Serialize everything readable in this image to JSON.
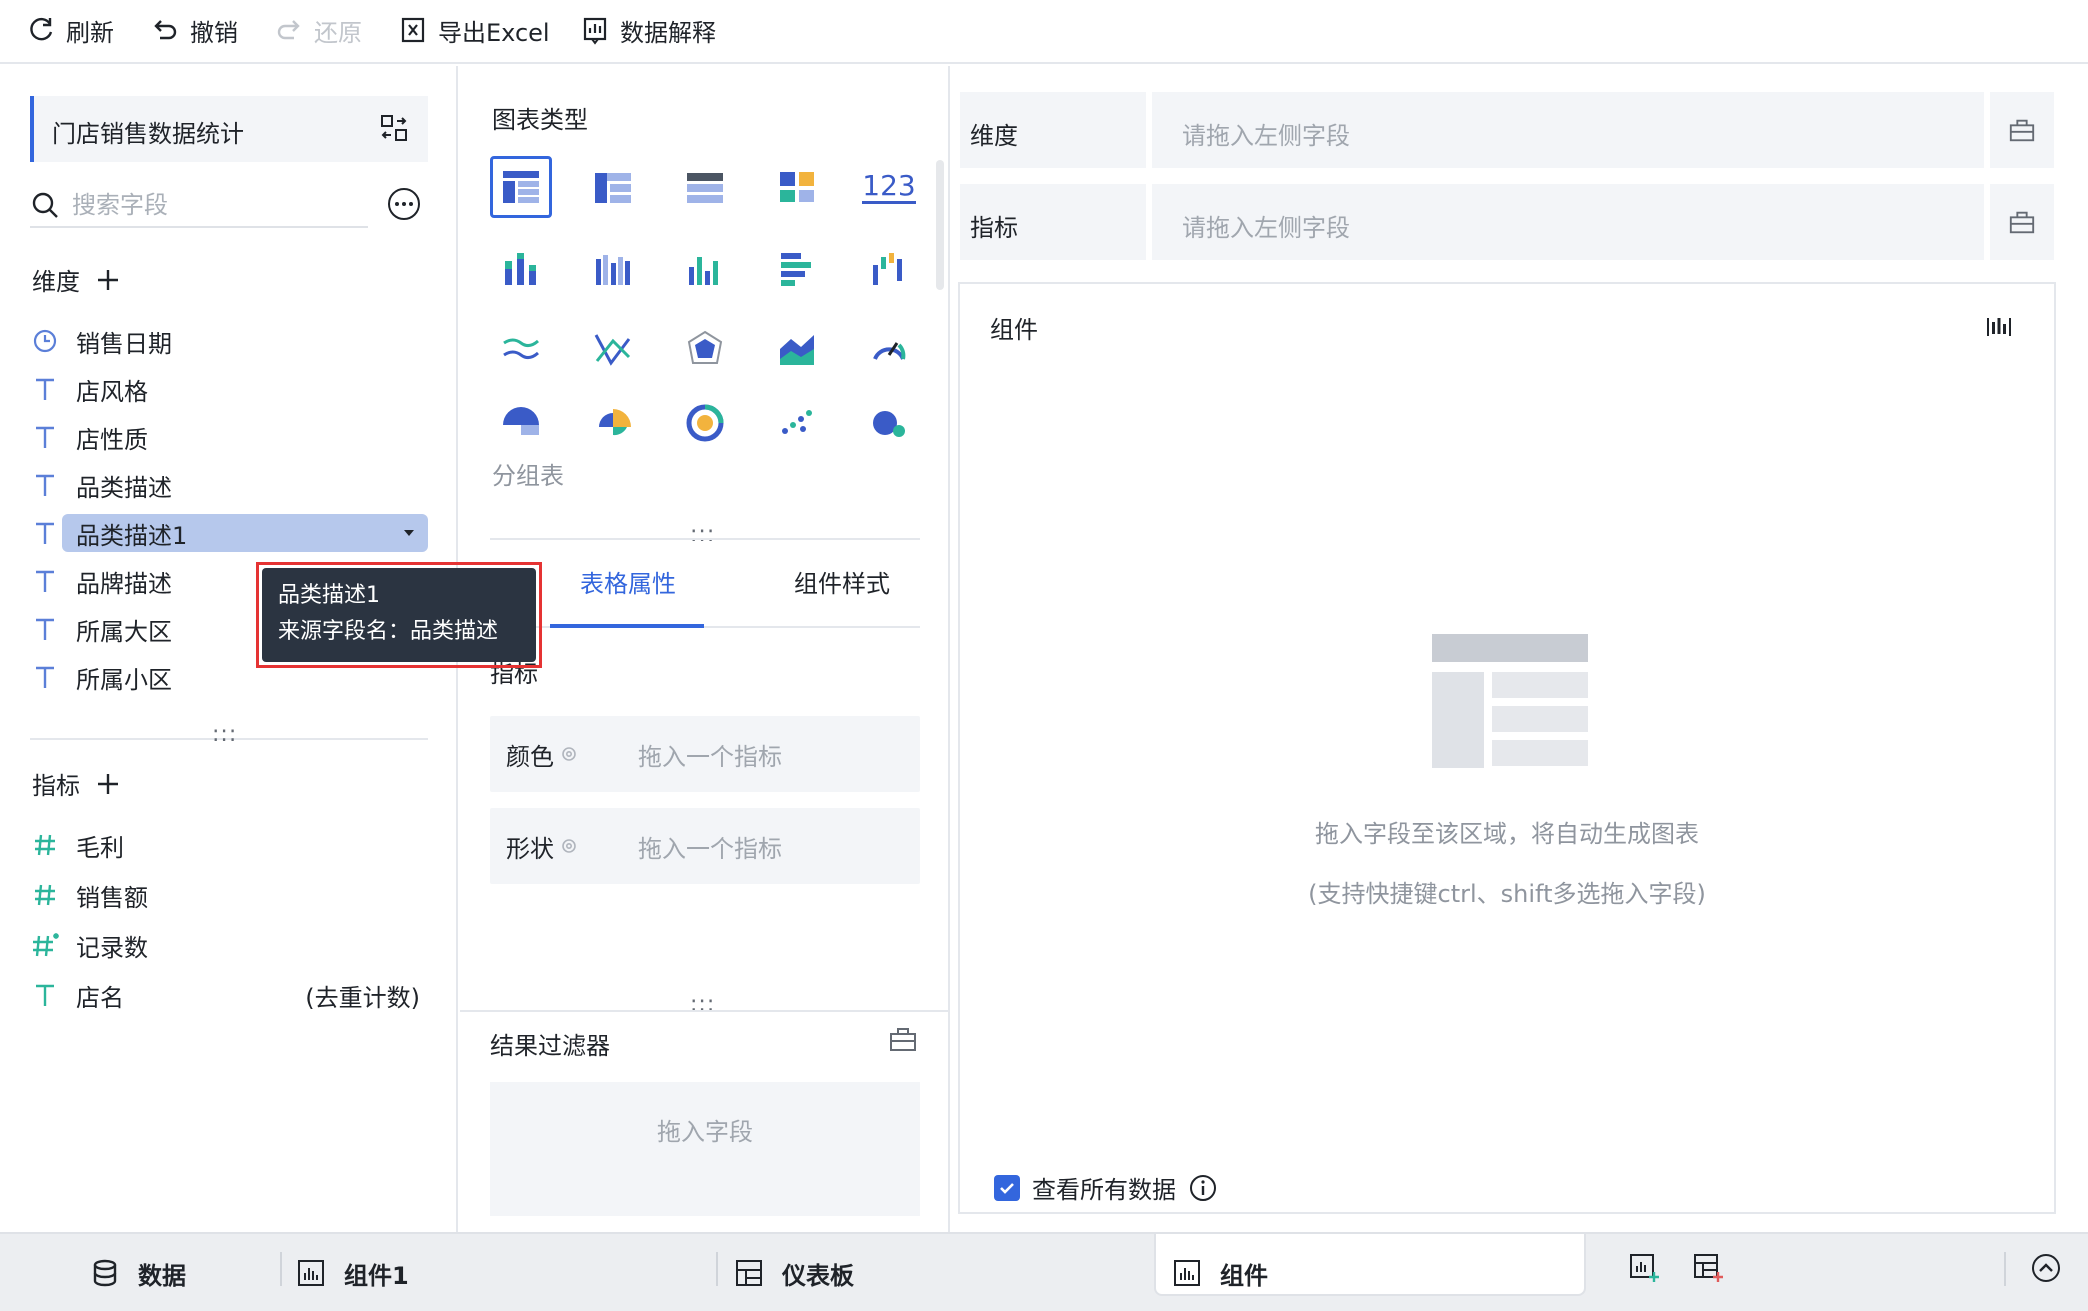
{
  "toolbar": {
    "refresh": "刷新",
    "undo": "撤销",
    "redo": "还原",
    "export": "导出Excel",
    "explain": "数据解释"
  },
  "left": {
    "dataset_name": "门店销售数据统计",
    "search_placeholder": "搜索字段",
    "dimension_title": "维度",
    "dimensions": [
      {
        "label": "销售日期",
        "icon": "clock-icon"
      },
      {
        "label": "店风格",
        "icon": "text-type-icon"
      },
      {
        "label": "店性质",
        "icon": "text-type-icon"
      },
      {
        "label": "品类描述",
        "icon": "text-type-icon"
      },
      {
        "label": "品类描述1",
        "icon": "text-type-icon"
      },
      {
        "label": "品牌描述",
        "icon": "text-type-icon"
      },
      {
        "label": "所属大区",
        "icon": "text-type-icon"
      },
      {
        "label": "所属小区",
        "icon": "text-type-icon"
      }
    ],
    "metric_title": "指标",
    "metrics": [
      {
        "label": "毛利",
        "icon": "number-type-icon"
      },
      {
        "label": "销售额",
        "icon": "number-type-icon"
      },
      {
        "label": "记录数",
        "icon": "record-count-icon"
      },
      {
        "label": "店名",
        "icon": "text-type-icon",
        "extra": "(去重计数)"
      }
    ],
    "divider": ":::"
  },
  "tooltip": {
    "line1": "品类描述1",
    "line2": "来源字段名：品类描述"
  },
  "middle": {
    "chart_type_title": "图表类型",
    "chart_123_label": "123",
    "selected_chart_name": "分组表",
    "tabs": [
      "表格属性",
      "组件样式"
    ],
    "metric_label": "指标",
    "color_label": "颜色",
    "shape_label": "形状",
    "slot_placeholder": "拖入一个指标",
    "filter_title": "结果过滤器",
    "filter_placeholder": "拖入字段",
    "divider": ":::"
  },
  "right": {
    "dimension_label": "维度",
    "metric_label": "指标",
    "drop_placeholder": "请拖入左侧字段",
    "canvas_title": "组件",
    "empty_hint1": "拖入字段至该区域，将自动生成图表",
    "empty_hint2": "(支持快捷键ctrl、shift多选拖入字段)",
    "view_all": "查看所有数据",
    "view_all_checked": true
  },
  "bottom": {
    "data_tab": "数据",
    "widget1_tab": "组件1",
    "dashboard_tab": "仪表板",
    "active_tab": "组件"
  },
  "colors": {
    "accent": "#3366dd",
    "selected_field_bg": "#b6c8ec",
    "tooltip_bg": "#2b3441",
    "highlight_frame": "#e53333"
  }
}
